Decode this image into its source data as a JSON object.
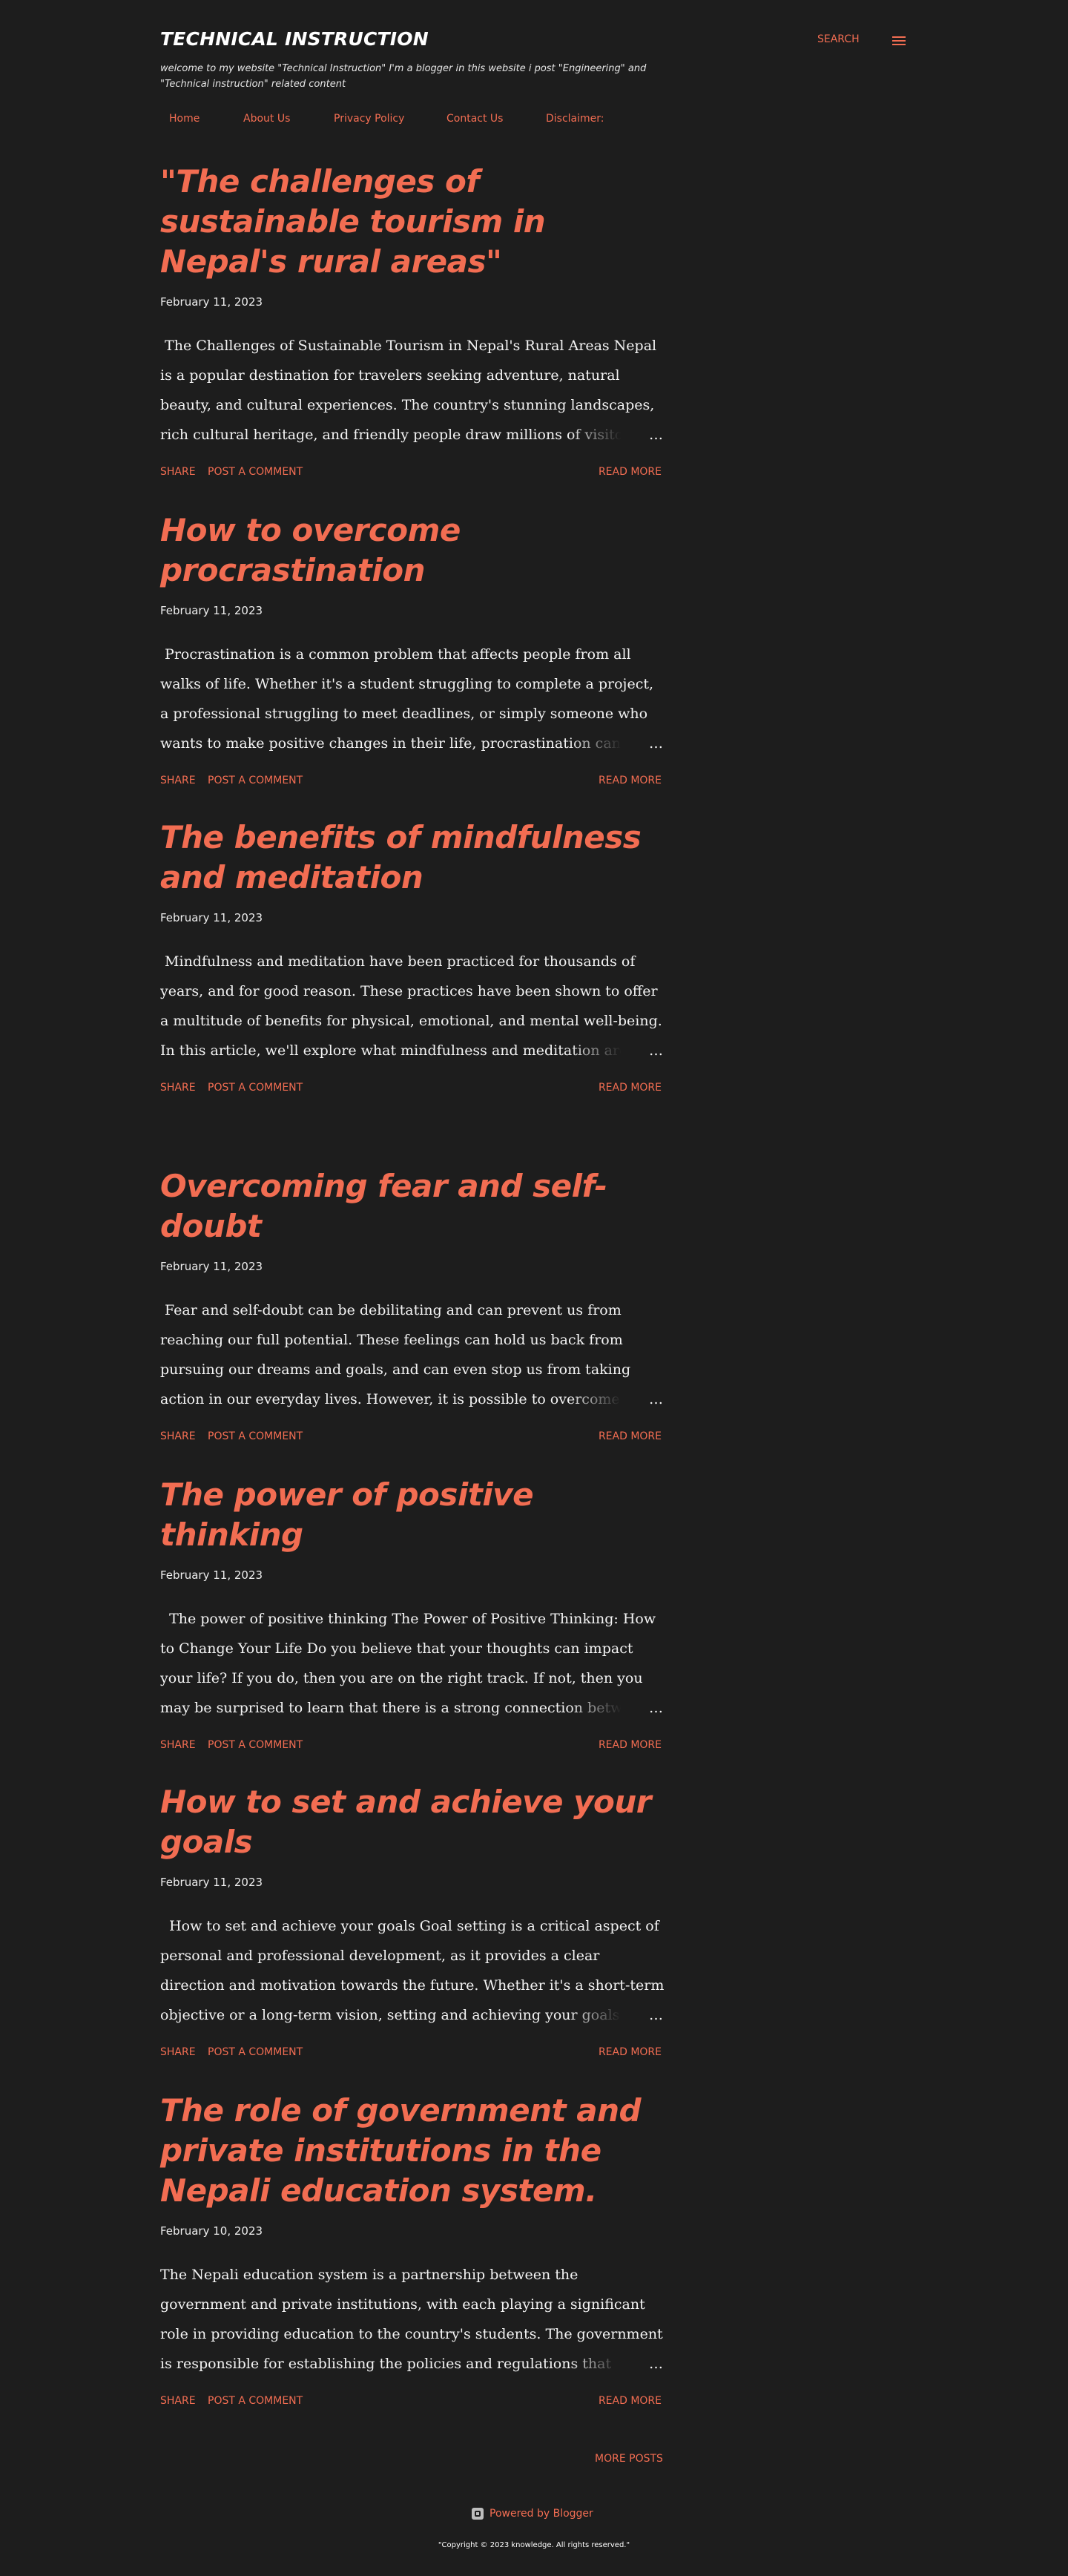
{
  "header": {
    "title": "TECHNICAL INSTRUCTION",
    "description": "welcome to my website \"Technical Instruction\" I'm a blogger in this website i post \"Engineering\" and \"Technical instruction\" related content",
    "search_label": "SEARCH",
    "menu_icon": "hamburger-menu-icon"
  },
  "nav": {
    "items": [
      "Home",
      "About Us",
      "Privacy Policy",
      "Contact Us",
      "Disclaimer:"
    ]
  },
  "posts": [
    {
      "title": "\"The challenges of sustainable tourism in Nepal's rural areas\"",
      "date": "February 11, 2023",
      "snippet": " The Challenges of Sustainable Tourism in Nepal's Rural Areas Nepal is a popular destination for travelers seeking adventure, natural beauty, and cultural experiences. The country's stunning landscapes, rich cultural heritage, and friendly people draw millions of visitors each year.",
      "ellipsis": "…",
      "share": "SHARE",
      "comment": "POST A COMMENT",
      "read_more": "READ MORE"
    },
    {
      "title": "How to overcome procrastination",
      "date": "February 11, 2023",
      "snippet": " Procrastination is a common problem that affects people from all walks of life. Whether it's a student struggling to complete a project, a professional struggling to meet deadlines, or simply someone who wants to make positive changes in their life, procrastination can be a major",
      "ellipsis": "…",
      "share": "SHARE",
      "comment": "POST A COMMENT",
      "read_more": "READ MORE"
    },
    {
      "title": "The benefits of mindfulness and meditation",
      "date": "February 11, 2023",
      "snippet": " Mindfulness and meditation have been practiced for thousands of years, and for good reason. These practices have been shown to offer a multitude of benefits for physical, emotional, and mental well-being. In this article, we'll explore what mindfulness and meditation are, how th",
      "ellipsis": "…",
      "share": "SHARE",
      "comment": "POST A COMMENT",
      "read_more": "READ MORE"
    },
    {
      "title": "Overcoming fear and self-doubt",
      "date": "February 11, 2023",
      "snippet": " Fear and self-doubt can be debilitating and can prevent us from reaching our full potential. These feelings can hold us back from pursuing our dreams and goals, and can even stop us from taking action in our everyday lives. However, it is possible to overcome fear and self",
      "ellipsis": "…",
      "share": "SHARE",
      "comment": "POST A COMMENT",
      "read_more": "READ MORE"
    },
    {
      "title": "The power of positive thinking",
      "date": "February 11, 2023",
      "snippet": "  The power of positive thinking The Power of Positive Thinking: How to Change Your Life Do you believe that your thoughts can impact your life? If you do, then you are on the right track. If not, then you may be surprised to learn that there is a strong connection between our",
      "ellipsis": "…",
      "share": "SHARE",
      "comment": "POST A COMMENT",
      "read_more": "READ MORE"
    },
    {
      "title": "How to set and achieve your goals",
      "date": "February 11, 2023",
      "snippet": "  How to set and achieve your goals Goal setting is a critical aspect of personal and professional development, as it provides a clear direction and motivation towards the future. Whether it's a short-term objective or a long-term vision, setting and achieving your goals can have a",
      "ellipsis": "…",
      "share": "SHARE",
      "comment": "POST A COMMENT",
      "read_more": "READ MORE"
    },
    {
      "title": "The role of government and private institutions in the Nepali education system.",
      "date": "February 10, 2023",
      "snippet": "The Nepali education system is a partnership between the government and private institutions, with each playing a significant role in providing education to the country's students. The government is responsible for establishing the policies and regulations that govern the education",
      "ellipsis": "…",
      "share": "SHARE",
      "comment": "POST A COMMENT",
      "read_more": "READ MORE"
    }
  ],
  "footer": {
    "more_posts": "MORE POSTS",
    "powered_by": "Powered by Blogger",
    "powered_icon": "blogger-logo-icon",
    "copyright": "\"Copyright © 2023 knowledge. All rights reserved.\""
  },
  "colors": {
    "background": "#1d1d1d",
    "accent": "#f26d52",
    "text": "#eeeeee"
  }
}
